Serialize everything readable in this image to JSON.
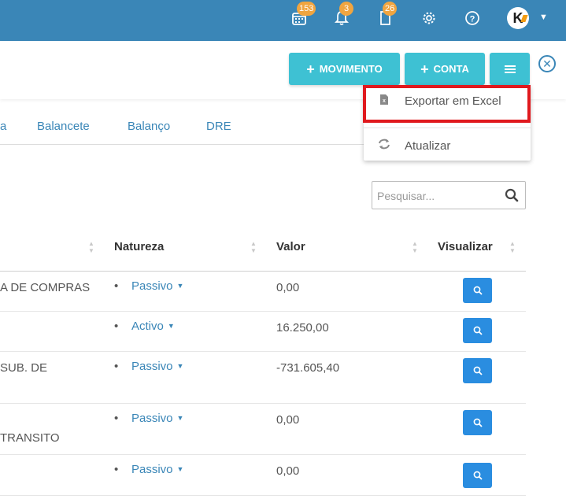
{
  "topbar": {
    "calendar_badge": "153",
    "bell_badge": "3",
    "doc_badge": "26",
    "avatar_letter": "K"
  },
  "actions": {
    "movimento_label": "MOVIMENTO",
    "conta_label": "CONTA"
  },
  "dropdown": {
    "items": [
      {
        "label": "Exportar em Excel",
        "icon": "excel-file-icon"
      },
      {
        "label": "Atualizar",
        "icon": "refresh-icon"
      }
    ]
  },
  "tabs": [
    "a",
    "Balancete",
    "Balanço",
    "DRE"
  ],
  "search": {
    "placeholder": "Pesquisar..."
  },
  "table": {
    "columns": [
      "Natureza",
      "Valor",
      "Visualizar"
    ],
    "rows": [
      {
        "desc": "A DE COMPRAS",
        "natureza": "Passivo",
        "valor": "0,00"
      },
      {
        "desc": "",
        "natureza": "Activo",
        "valor": "16.250,00"
      },
      {
        "desc": "SUB. DE",
        "natureza": "Passivo",
        "valor": "-731.605,40"
      },
      {
        "desc": "TRANSITO",
        "natureza": "Passivo",
        "valor": "0,00"
      },
      {
        "desc": "",
        "natureza": "Passivo",
        "valor": "0,00"
      }
    ]
  },
  "colors": {
    "topbar": "#3a86b7",
    "action_button": "#3ec1d3",
    "view_button": "#2a8de0",
    "badge": "#f0a540",
    "highlight": "#e0191e"
  }
}
